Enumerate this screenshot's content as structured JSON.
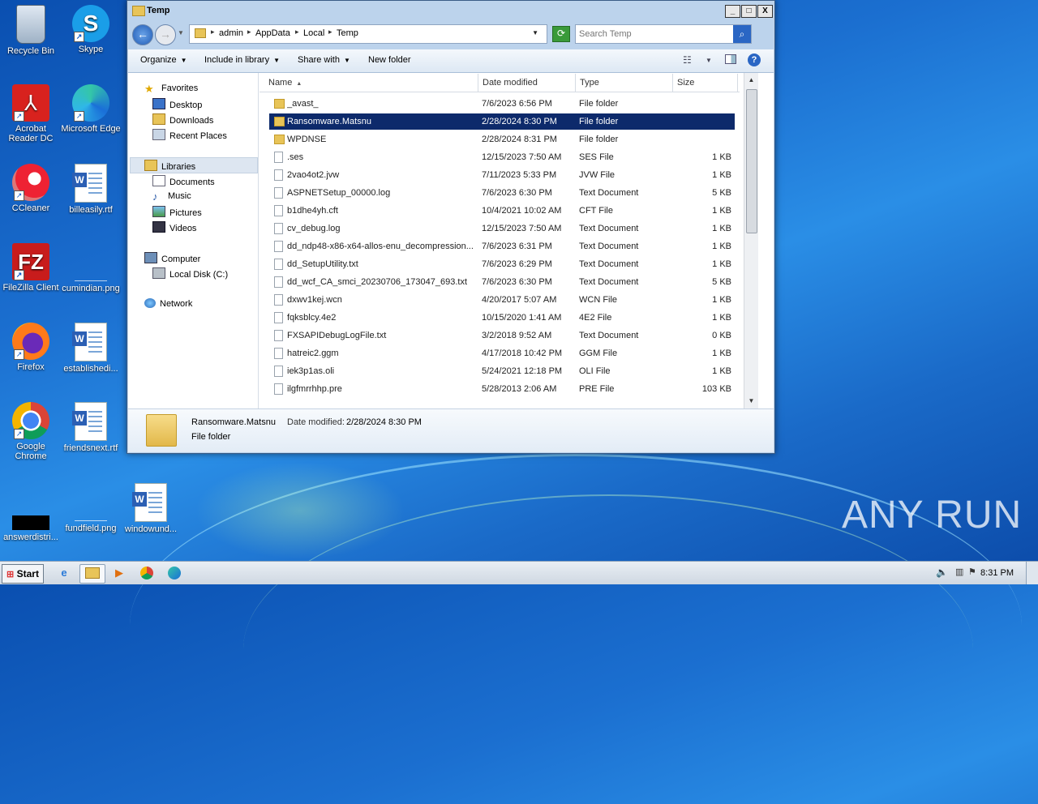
{
  "desktop": {
    "icons": [
      {
        "label": "Recycle Bin",
        "icon": "recycle-bin-icon",
        "shortcut": false
      },
      {
        "label": "Skype",
        "icon": "skype-icon",
        "shortcut": true
      },
      {
        "label": "Acrobat Reader DC",
        "icon": "acrobat-icon",
        "shortcut": true
      },
      {
        "label": "Microsoft Edge",
        "icon": "edge-icon",
        "shortcut": true
      },
      {
        "label": "CCleaner",
        "icon": "ccleaner-icon",
        "shortcut": true
      },
      {
        "label": "billeasily.rtf",
        "icon": "word-doc-icon",
        "shortcut": false
      },
      {
        "label": "FileZilla Client",
        "icon": "filezilla-icon",
        "shortcut": true
      },
      {
        "label": "cumindian.png",
        "icon": "image-file-icon",
        "shortcut": false
      },
      {
        "label": "Firefox",
        "icon": "firefox-icon",
        "shortcut": true
      },
      {
        "label": "establishedi...",
        "icon": "word-doc-icon",
        "shortcut": false
      },
      {
        "label": "Google Chrome",
        "icon": "chrome-icon",
        "shortcut": true
      },
      {
        "label": "friendsnext.rtf",
        "icon": "word-doc-icon",
        "shortcut": false
      },
      {
        "label": "answerdistri...",
        "icon": "image-file-icon",
        "shortcut": false
      },
      {
        "label": "fundfield.png",
        "icon": "image-file-icon",
        "shortcut": false
      },
      {
        "label": "windowund...",
        "icon": "word-doc-icon",
        "shortcut": false
      }
    ],
    "watermark": "ANY RUN"
  },
  "window": {
    "title": "Temp",
    "controls": {
      "minimize": "_",
      "maximize": "□",
      "close": "X"
    },
    "breadcrumb": [
      "admin",
      "AppData",
      "Local",
      "Temp"
    ],
    "search_placeholder": "Search Temp",
    "toolbar": {
      "organize": "Organize",
      "include_in_library": "Include in library",
      "share_with": "Share with",
      "new_folder": "New folder"
    },
    "nav": {
      "favorites": "Favorites",
      "desktop": "Desktop",
      "downloads": "Downloads",
      "recent_places": "Recent Places",
      "libraries": "Libraries",
      "documents": "Documents",
      "music": "Music",
      "pictures": "Pictures",
      "videos": "Videos",
      "computer": "Computer",
      "local_disk": "Local Disk (C:)",
      "network": "Network"
    },
    "columns": {
      "name": "Name",
      "date_modified": "Date modified",
      "type": "Type",
      "size": "Size"
    },
    "files": [
      {
        "name": "_avast_",
        "date": "7/6/2023 6:56 PM",
        "type": "File folder",
        "size": "",
        "kind": "folder"
      },
      {
        "name": "Ransomware.Matsnu",
        "date": "2/28/2024 8:30 PM",
        "type": "File folder",
        "size": "",
        "kind": "folder",
        "selected": true
      },
      {
        "name": "WPDNSE",
        "date": "2/28/2024 8:31 PM",
        "type": "File folder",
        "size": "",
        "kind": "folder"
      },
      {
        "name": ".ses",
        "date": "12/15/2023 7:50 AM",
        "type": "SES File",
        "size": "1 KB",
        "kind": "file"
      },
      {
        "name": "2vao4ot2.jvw",
        "date": "7/11/2023 5:33 PM",
        "type": "JVW File",
        "size": "1 KB",
        "kind": "file"
      },
      {
        "name": "ASPNETSetup_00000.log",
        "date": "7/6/2023 6:30 PM",
        "type": "Text Document",
        "size": "5 KB",
        "kind": "file"
      },
      {
        "name": "b1dhe4yh.cft",
        "date": "10/4/2021 10:02 AM",
        "type": "CFT File",
        "size": "1 KB",
        "kind": "file"
      },
      {
        "name": "cv_debug.log",
        "date": "12/15/2023 7:50 AM",
        "type": "Text Document",
        "size": "1 KB",
        "kind": "file"
      },
      {
        "name": "dd_ndp48-x86-x64-allos-enu_decompression...",
        "date": "7/6/2023 6:31 PM",
        "type": "Text Document",
        "size": "1 KB",
        "kind": "file"
      },
      {
        "name": "dd_SetupUtility.txt",
        "date": "7/6/2023 6:29 PM",
        "type": "Text Document",
        "size": "1 KB",
        "kind": "file"
      },
      {
        "name": "dd_wcf_CA_smci_20230706_173047_693.txt",
        "date": "7/6/2023 6:30 PM",
        "type": "Text Document",
        "size": "5 KB",
        "kind": "file"
      },
      {
        "name": "dxwv1kej.wcn",
        "date": "4/20/2017 5:07 AM",
        "type": "WCN File",
        "size": "1 KB",
        "kind": "file"
      },
      {
        "name": "fqksblcy.4e2",
        "date": "10/15/2020 1:41 AM",
        "type": "4E2 File",
        "size": "1 KB",
        "kind": "file"
      },
      {
        "name": "FXSAPIDebugLogFile.txt",
        "date": "3/2/2018 9:52 AM",
        "type": "Text Document",
        "size": "0 KB",
        "kind": "file"
      },
      {
        "name": "hatreic2.ggm",
        "date": "4/17/2018 10:42 PM",
        "type": "GGM File",
        "size": "1 KB",
        "kind": "file"
      },
      {
        "name": "iek3p1as.oli",
        "date": "5/24/2021 12:18 PM",
        "type": "OLI File",
        "size": "1 KB",
        "kind": "file"
      },
      {
        "name": "ilgfmrrhhp.pre",
        "date": "5/28/2013 2:06 AM",
        "type": "PRE File",
        "size": "103 KB",
        "kind": "file"
      }
    ],
    "details": {
      "name": "Ransomware.Matsnu",
      "date_label": "Date modified:",
      "date_value": "2/28/2024 8:30 PM",
      "type": "File folder"
    }
  },
  "taskbar": {
    "start": "Start",
    "clock": "8:31 PM"
  }
}
